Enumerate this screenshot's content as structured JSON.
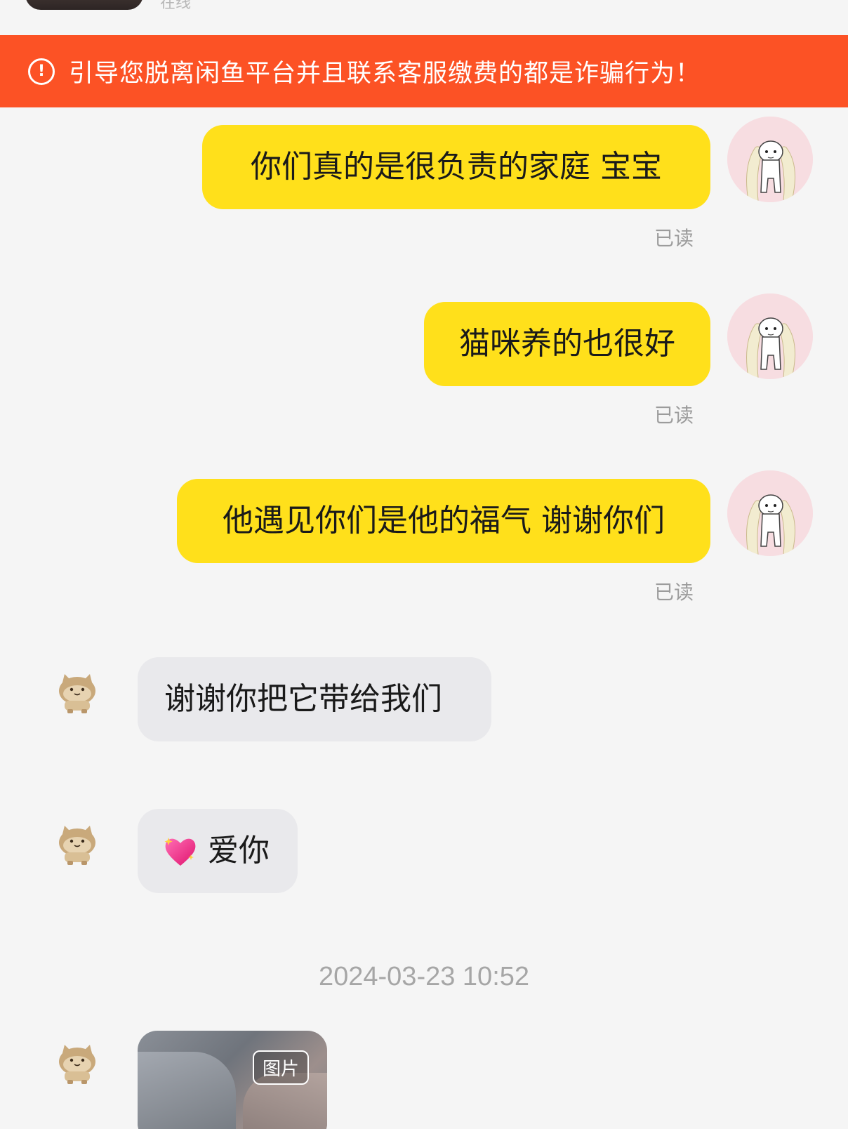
{
  "header": {
    "subtitle": "在线"
  },
  "warning": {
    "icon": "exclamation-circle-icon",
    "text": "引导您脱离闲鱼平台并且联系客服缴费的都是诈骗行为！",
    "bg_color": "#fc5225"
  },
  "messages": [
    {
      "from": "me",
      "text": "你们真的是很负责的家庭 宝宝",
      "status": "已读"
    },
    {
      "from": "me",
      "text": "猫咪养的也很好",
      "status": "已读"
    },
    {
      "from": "me",
      "text": "他遇见你们是他的福气 谢谢你们",
      "status": "已读"
    },
    {
      "from": "them",
      "text": "谢谢你把它带给我们"
    },
    {
      "from": "them",
      "emoji": "sparkling-heart-icon",
      "text": "爱你"
    }
  ],
  "timestamp": "2024-03-23 10:52",
  "image_message": {
    "from": "them",
    "badge": "图片"
  },
  "colors": {
    "outgoing_bubble": "#ffe01b",
    "incoming_bubble": "#e9e9ec",
    "background": "#f5f5f5"
  }
}
